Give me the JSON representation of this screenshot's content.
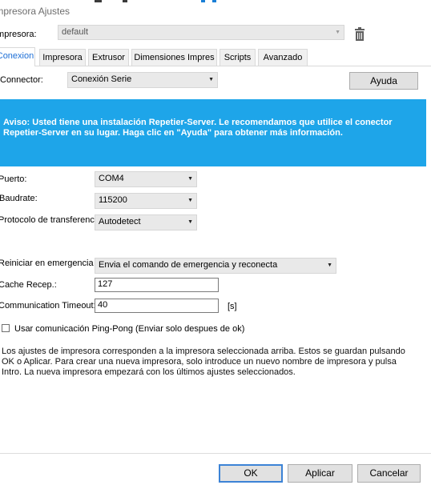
{
  "window": {
    "title": "Impresora Ajustes"
  },
  "printer": {
    "label": "Impresora:",
    "selected": "default",
    "delete_icon": "trash-icon"
  },
  "tabs": [
    {
      "label": "Conexion",
      "active": true
    },
    {
      "label": "Impresora",
      "active": false
    },
    {
      "label": "Extrusor",
      "active": false
    },
    {
      "label": "Dimensiones Impres",
      "active": false
    },
    {
      "label": "Scripts",
      "active": false
    },
    {
      "label": "Avanzado",
      "active": false
    }
  ],
  "connection": {
    "connector_label": "Connector:",
    "connector_value": "Conexión Serie",
    "help_button": "Ayuda",
    "warning": "Aviso: Usted tiene una instalación Repetier-Server. Le recomendamos que utilice el conector Repetier-Server en su lugar. Haga clic en \"Ayuda\" para obtener más información.",
    "port_label": "Puerto:",
    "port_value": "COM4",
    "baudrate_label": "Baudrate:",
    "baudrate_value": "115200",
    "protocol_label": "Protocolo de transferencia:",
    "protocol_value": "Autodetect",
    "reset_label": "Reiniciar en emergencia",
    "reset_value": "Envia el comando de emergencia y reconecta",
    "cache_label": "Cache Recep.:",
    "cache_value": "127",
    "timeout_label": "Communication Timeout:",
    "timeout_value": "40",
    "timeout_unit": "[s]",
    "pingpong_label": "Usar comunicación Ping-Pong (Enviar solo despues de ok)",
    "pingpong_checked": false,
    "info_text": "Los ajustes de impresora corresponden a la impresora seleccionada arriba. Estos se guardan pulsando OK o Aplicar. Para crear una nueva impresora, solo introduce un nuevo nombre de impresora y pulsa Intro. La nueva impresora empezará con los últimos ajustes seleccionados."
  },
  "footer": {
    "ok": "OK",
    "apply": "Aplicar",
    "cancel": "Cancelar"
  },
  "colors": {
    "banner": "#1ea5e9",
    "accent": "#1c6ed6",
    "default_button_border": "#3c83d6"
  }
}
